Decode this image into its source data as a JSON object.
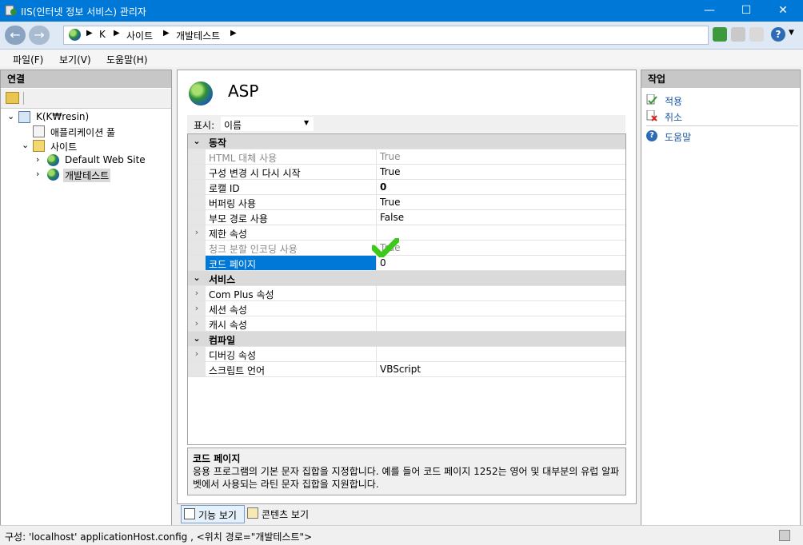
{
  "window": {
    "title": "IIS(인터넷 정보 서비스) 관리자",
    "controls": {
      "minimize": "—",
      "maximize": "☐",
      "close": "✕"
    }
  },
  "address": {
    "breadcrumbs": [
      "K",
      "사이트",
      "개발테스트"
    ]
  },
  "menu": [
    "파일(F)",
    "보기(V)",
    "도움말(H)"
  ],
  "connections": {
    "header": "연결",
    "tree": [
      {
        "label": "K(K₩resin)",
        "level": 0,
        "expander": "⌄"
      },
      {
        "label": "애플리케이션 풀",
        "level": 1,
        "expander": ""
      },
      {
        "label": "사이트",
        "level": 1,
        "expander": "⌄"
      },
      {
        "label": "Default Web Site",
        "level": 2,
        "expander": "›"
      },
      {
        "label": "개발테스트",
        "level": 2,
        "expander": "›",
        "selected": true
      }
    ]
  },
  "feature": {
    "title": "ASP",
    "display_label": "표시:",
    "display_value": "이름",
    "rows": [
      {
        "type": "cat",
        "name": "동작",
        "expander": "⌄"
      },
      {
        "type": "prop",
        "name": "HTML 대체 사용",
        "value": "True",
        "dim": true
      },
      {
        "type": "prop",
        "name": "구성 변경 시 다시 시작",
        "value": "True"
      },
      {
        "type": "prop",
        "name": "로캘 ID",
        "value": "0",
        "bold": true
      },
      {
        "type": "prop",
        "name": "버퍼링 사용",
        "value": "True"
      },
      {
        "type": "prop",
        "name": "부모 경로 사용",
        "value": "False"
      },
      {
        "type": "prop",
        "name": "제한 속성",
        "value": "",
        "expander": "›"
      },
      {
        "type": "prop",
        "name": "청크 분할 인코딩 사용",
        "value": "True",
        "dim": true
      },
      {
        "type": "prop",
        "name": "코드 페이지",
        "value": "0",
        "selected": true
      },
      {
        "type": "cat",
        "name": "서비스",
        "expander": "⌄"
      },
      {
        "type": "prop",
        "name": "Com Plus 속성",
        "value": "",
        "expander": "›"
      },
      {
        "type": "prop",
        "name": "세션 속성",
        "value": "",
        "expander": "›"
      },
      {
        "type": "prop",
        "name": "캐시 속성",
        "value": "",
        "expander": "›"
      },
      {
        "type": "cat",
        "name": "컴파일",
        "expander": "⌄"
      },
      {
        "type": "prop",
        "name": "디버깅 속성",
        "value": "",
        "expander": "›"
      },
      {
        "type": "prop",
        "name": "스크립트 언어",
        "value": "VBScript"
      }
    ],
    "description_title": "코드 페이지",
    "description_text": "응용 프로그램의 기본 문자 집합을 지정합니다. 예를 들어 코드 페이지 1252는 영어 및 대부분의 유럽 알파벳에서 사용되는 라틴 문자 집합을 지원합니다.",
    "view_tabs": [
      "기능 보기",
      "콘텐츠 보기"
    ]
  },
  "actions": {
    "header": "작업",
    "apply": "적용",
    "cancel": "취소",
    "help": "도움말"
  },
  "status": "구성: 'localhost' applicationHost.config , <위치 경로=\"개발테스트\">",
  "colors": {
    "titlebar": "#0078d7",
    "selection": "#0078d7",
    "check": "#3ec81a"
  }
}
